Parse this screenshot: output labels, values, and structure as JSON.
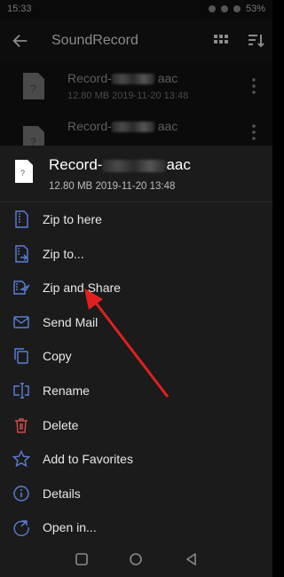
{
  "status_bar": {
    "time": "15:33",
    "battery": "53%"
  },
  "app_bar": {
    "title": "SoundRecord",
    "icons": [
      "back-arrow-icon",
      "grid-view-icon",
      "sort-icon"
    ]
  },
  "background_list": [
    {
      "name_prefix": "Record-",
      "name_suffix": "aac",
      "size": "12.80 MB",
      "date": "2019-11-20 13:48"
    },
    {
      "name_prefix": "Record-",
      "name_suffix": "aac",
      "size": "",
      "date": ""
    }
  ],
  "sheet": {
    "file_name_prefix": "Record-",
    "file_name_suffix": "aac",
    "size": "12.80 MB",
    "date": "2019-11-20 13:48",
    "items": [
      {
        "label": "Zip to here",
        "icon": "zip-icon"
      },
      {
        "label": "Zip to...",
        "icon": "zip-to-icon"
      },
      {
        "label": "Zip and Share",
        "icon": "zip-share-icon"
      },
      {
        "label": "Send Mail",
        "icon": "mail-icon"
      },
      {
        "label": "Copy",
        "icon": "copy-icon"
      },
      {
        "label": "Rename",
        "icon": "rename-icon"
      },
      {
        "label": "Delete",
        "icon": "delete-icon"
      },
      {
        "label": "Add to Favorites",
        "icon": "star-icon"
      },
      {
        "label": "Details",
        "icon": "info-icon"
      },
      {
        "label": "Open in...",
        "icon": "open-in-icon"
      }
    ]
  },
  "colors": {
    "menu_icon": "#5b7fd6",
    "delete_icon": "#d2504a",
    "arrow": "#e0201f",
    "sheet_bg": "#1b1b1b"
  },
  "nav_bar": {
    "icons": [
      "recents-icon",
      "home-icon",
      "back-icon"
    ]
  }
}
